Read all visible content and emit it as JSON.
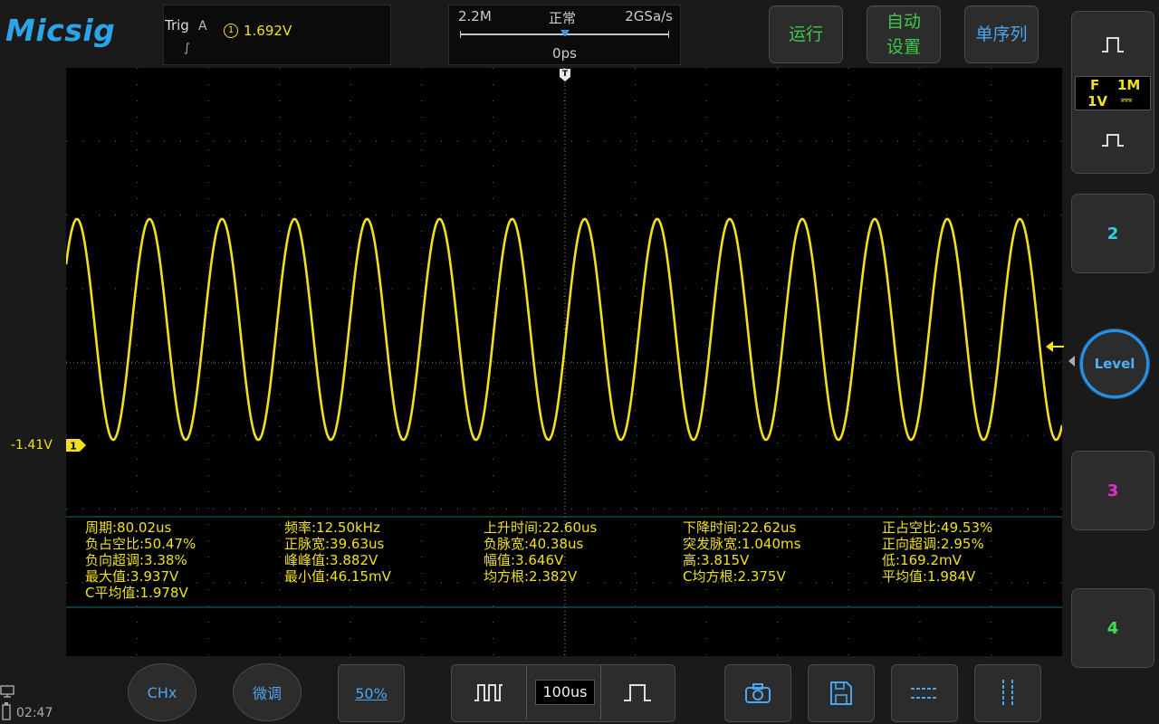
{
  "brand": "Micsig",
  "trigger": {
    "label": "Trig",
    "source": "A",
    "edge_symbol": "∫",
    "channel_mark": "1",
    "level": "1.692V"
  },
  "timebase": {
    "memory_depth": "2.2M",
    "mode": "正常",
    "sample_rate": "2GSa/s",
    "position": "0ps"
  },
  "top_buttons": {
    "run": "运行",
    "auto_line1": "自动",
    "auto_line2": "设置",
    "single": "单序列"
  },
  "side_panel": {
    "ch1_coupling": "F",
    "ch1_impedance": "1M",
    "ch1_scale": "1V",
    "ch1_dc": "⎓",
    "ch2": "2",
    "level": "Level",
    "ch3": "3",
    "ch4": "4"
  },
  "screen": {
    "trigger_marker": "T",
    "channel_marker": "1",
    "channel_offset": "-1.41V",
    "waveform_color": "#f0e020"
  },
  "measurements": [
    [
      "周期:80.02us",
      "频率:12.50kHz",
      "上升时间:22.60us",
      "下降时间:22.62us",
      "正占空比:49.53%"
    ],
    [
      "负占空比:50.47%",
      "正脉宽:39.63us",
      "负脉宽:40.38us",
      "突发脉宽:1.040ms",
      "正向超调:2.95%"
    ],
    [
      "负向超调:3.38%",
      "峰峰值:3.882V",
      "幅值:3.646V",
      "高:3.815V",
      "低:169.2mV"
    ],
    [
      "最大值:3.937V",
      "最小值:46.15mV",
      "均方根:2.382V",
      "C均方根:2.375V",
      "平均值:1.984V"
    ],
    [
      "C平均值:1.978V",
      "",
      "",
      "",
      ""
    ]
  ],
  "bottom_bar": {
    "chx": "CHx",
    "fine": "微调",
    "fifty": "50%",
    "time_per_div": "100us",
    "camera_icon": "camera-icon",
    "save_icon": "save-icon",
    "cursor_h_icon": "horizontal-cursor-icon",
    "cursor_v_icon": "vertical-cursor-icon"
  },
  "status": {
    "time": "02:47"
  }
}
